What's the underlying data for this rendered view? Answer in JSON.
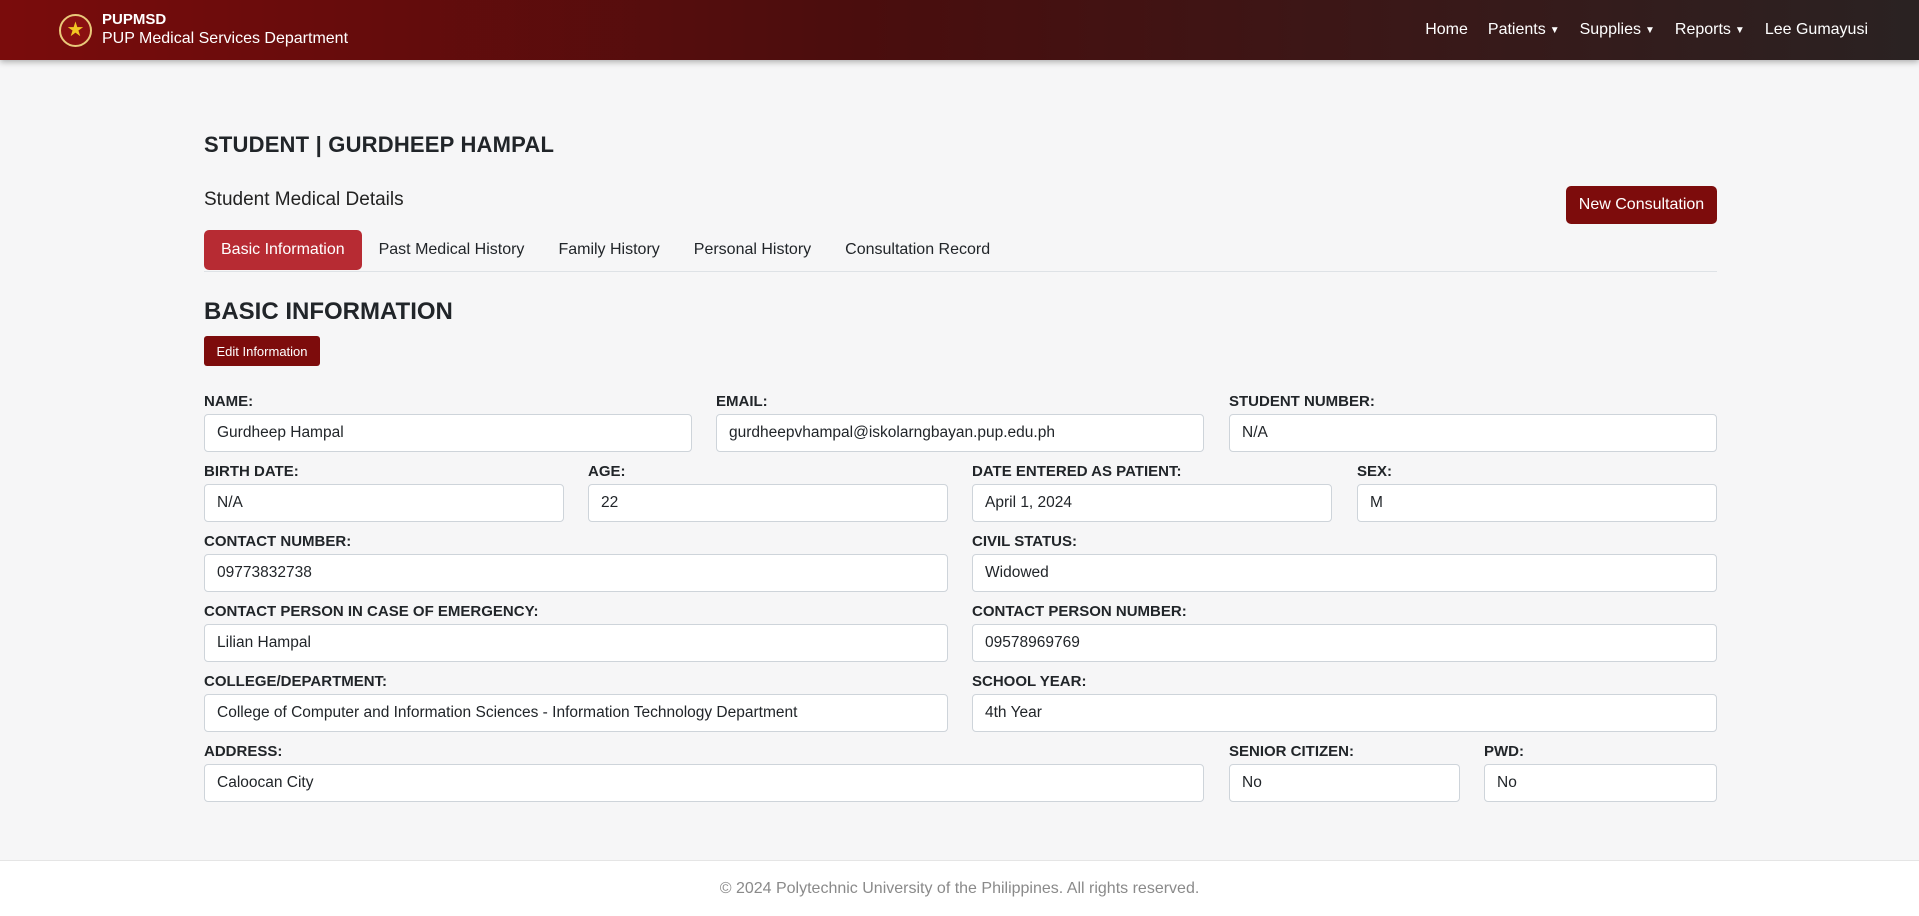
{
  "navbar": {
    "brand_short": "PUPMSD",
    "brand_long": "PUP Medical Services Department",
    "links": {
      "home": "Home",
      "patients": "Patients",
      "supplies": "Supplies",
      "reports": "Reports",
      "user": "Lee Gumayusi"
    }
  },
  "page": {
    "title": "STUDENT | GURDHEEP HAMPAL",
    "subtitle": "Student Medical Details",
    "new_consultation": "New Consultation"
  },
  "tabs": [
    "Basic Information",
    "Past Medical History",
    "Family History",
    "Personal History",
    "Consultation Record"
  ],
  "section": {
    "title": "BASIC INFORMATION",
    "edit_button": "Edit Information"
  },
  "fields": {
    "name": {
      "label": "NAME:",
      "value": "Gurdheep Hampal"
    },
    "email": {
      "label": "EMAIL:",
      "value": "gurdheepvhampal@iskolarngbayan.pup.edu.ph"
    },
    "student_number": {
      "label": "STUDENT NUMBER:",
      "value": "N/A"
    },
    "birth_date": {
      "label": "BIRTH DATE:",
      "value": "N/A"
    },
    "age": {
      "label": "AGE:",
      "value": "22"
    },
    "date_entered": {
      "label": "DATE ENTERED AS PATIENT:",
      "value": "April 1, 2024"
    },
    "sex": {
      "label": "SEX:",
      "value": "M"
    },
    "contact_number": {
      "label": "CONTACT NUMBER:",
      "value": "09773832738"
    },
    "civil_status": {
      "label": "CIVIL STATUS:",
      "value": "Widowed"
    },
    "emergency_contact": {
      "label": "CONTACT PERSON IN CASE OF EMERGENCY:",
      "value": "Lilian Hampal"
    },
    "emergency_number": {
      "label": "CONTACT PERSON NUMBER:",
      "value": "09578969769"
    },
    "college": {
      "label": "COLLEGE/DEPARTMENT:",
      "value": "College of Computer and Information Sciences - Information Technology Department"
    },
    "school_year": {
      "label": "SCHOOL YEAR:",
      "value": "4th Year"
    },
    "address": {
      "label": "ADDRESS:",
      "value": "Caloocan City"
    },
    "senior_citizen": {
      "label": "SENIOR CITIZEN:",
      "value": "No"
    },
    "pwd": {
      "label": "PWD:",
      "value": "No"
    }
  },
  "footer": "© 2024 Polytechnic University of the Philippines. All rights reserved.",
  "colors": {
    "brand": "#7d0c0c",
    "active_tab": "#b72b33"
  },
  "icons": {
    "logo": "pup-seal-icon",
    "dropdown": "caret-down-icon"
  }
}
